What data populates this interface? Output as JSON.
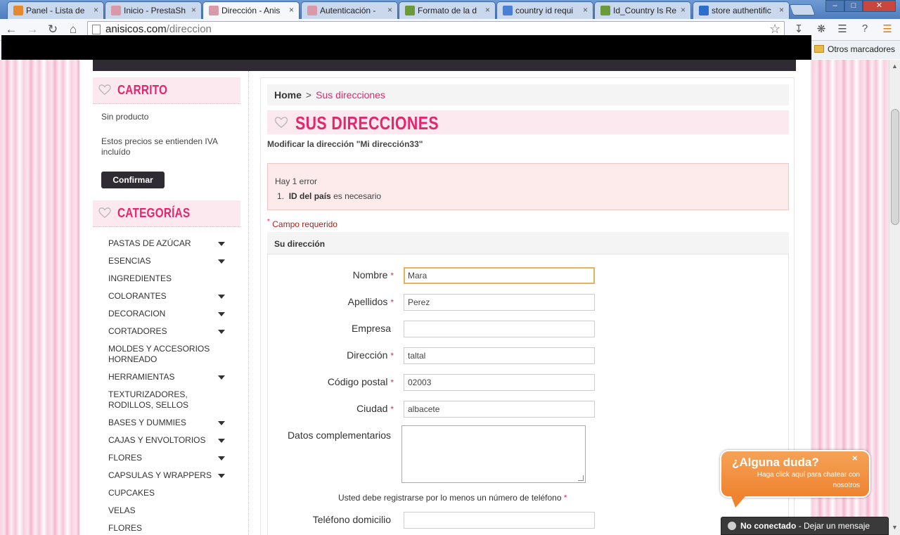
{
  "browser": {
    "tabs": [
      {
        "title": "Panel - Lista de",
        "icon": "prestashop-icon",
        "color": "#e5892f"
      },
      {
        "title": "Inicio - PrestaSh",
        "icon": "cupcake-icon",
        "color": "#d89aa8"
      },
      {
        "title": "Dirección - Anis",
        "icon": "cupcake-icon",
        "color": "#d89aa8",
        "active": true
      },
      {
        "title": "Autenticación -",
        "icon": "cupcake-icon",
        "color": "#d89aa8"
      },
      {
        "title": "Formato de la d",
        "icon": "prestashop-forum-icon",
        "color": "#6a9a3a"
      },
      {
        "title": "country id requi",
        "icon": "google-icon",
        "color": "#4a7fd8"
      },
      {
        "title": "Id_Country Is Re",
        "icon": "prestashop-forum-icon",
        "color": "#6a9a3a"
      },
      {
        "title": "store authentific",
        "icon": "shopping-bag-icon",
        "color": "#2a6fc9"
      }
    ],
    "url_host": "anisicos.com",
    "url_path": "/direccion",
    "bookmarks_other": "Otros marcadores"
  },
  "sidebar": {
    "cart_title": "CARRITO",
    "cart_empty": "Sin producto",
    "cart_tax_note": "Estos precios se entienden IVA incluído",
    "confirm_label": "Confirmar",
    "categories_title": "CATEGORÍAS",
    "categories": [
      {
        "label": "PASTAS DE AZÚCAR",
        "expandable": true
      },
      {
        "label": "ESENCIAS",
        "expandable": true
      },
      {
        "label": "INGREDIENTES",
        "expandable": false
      },
      {
        "label": "COLORANTES",
        "expandable": true
      },
      {
        "label": "DECORACION",
        "expandable": true
      },
      {
        "label": "CORTADORES",
        "expandable": true
      },
      {
        "label": "MOLDES Y ACCESORIOS HORNEADO",
        "expandable": false
      },
      {
        "label": "HERRAMIENTAS",
        "expandable": true
      },
      {
        "label": "TEXTURIZADORES, RODILLOS, SELLOS",
        "expandable": false
      },
      {
        "label": "BASES Y DUMMIES",
        "expandable": true
      },
      {
        "label": "CAJAS Y ENVOLTORIOS",
        "expandable": true
      },
      {
        "label": "FLORES",
        "expandable": true
      },
      {
        "label": "CAPSULAS Y WRAPPERS",
        "expandable": true
      },
      {
        "label": "CUPCAKES",
        "expandable": false
      },
      {
        "label": "VELAS",
        "expandable": false
      },
      {
        "label": "FLORES",
        "expandable": false
      }
    ]
  },
  "breadcrumb": {
    "home": "Home",
    "separator": ">",
    "current": "Sus direcciones"
  },
  "heading": "SUS DIRECCIONES",
  "subtitle": "Modificar la dirección \"Mi dirección33\"",
  "error": {
    "summary": "Hay 1 error",
    "index": "1.",
    "field": "ID del país",
    "message": "es necesario"
  },
  "required_note": "Campo requerido",
  "required_mark": "*",
  "form": {
    "section_title": "Su dirección",
    "fields": {
      "nombre": {
        "label": "Nombre",
        "value": "Mara"
      },
      "apellidos": {
        "label": "Apellidos",
        "value": "Perez"
      },
      "empresa": {
        "label": "Empresa",
        "value": ""
      },
      "direccion": {
        "label": "Dirección",
        "value": "taltal"
      },
      "codigo_postal": {
        "label": "Código postal",
        "value": "02003"
      },
      "ciudad": {
        "label": "Ciudad",
        "value": "albacete"
      },
      "datos": {
        "label": "Datos complementarios",
        "value": ""
      },
      "telefono": {
        "label": "Teléfono domicilio",
        "value": ""
      }
    },
    "phone_note": "Usted debe registrarse por lo menos un número de teléfono"
  },
  "chat": {
    "title": "¿Alguna duda?",
    "subtitle": "Haga click aquí para chatear con nosotros",
    "close": "×",
    "status": "No conectado",
    "status_action": "- Dejar un mensaje"
  },
  "colors": {
    "accent": "#e5266c",
    "dark": "#2f2b32",
    "chat": "#ee8330",
    "error_bg": "#fdeaea"
  }
}
